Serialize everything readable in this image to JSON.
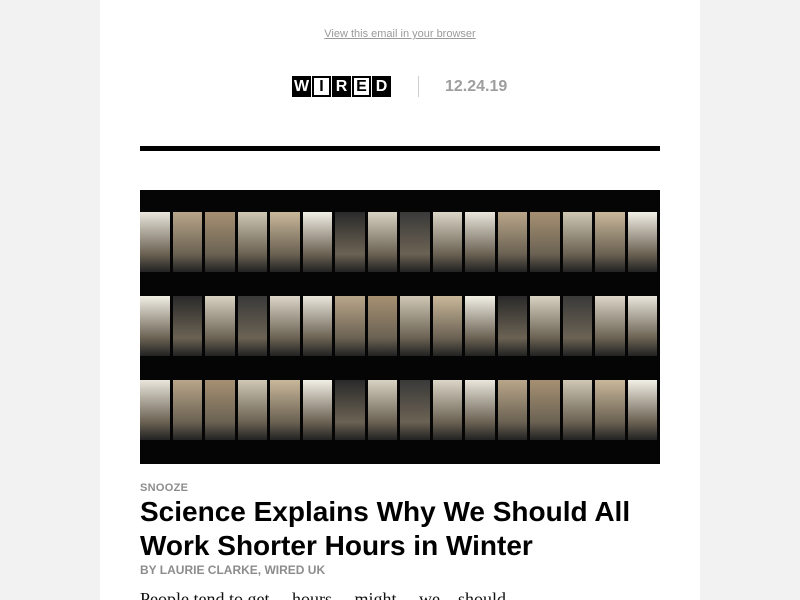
{
  "header": {
    "view_in_browser": "View this email in your browser",
    "logo_letters": [
      "W",
      "I",
      "R",
      "E",
      "D"
    ],
    "logo_text": "WIRED",
    "date": "12.24.19"
  },
  "article": {
    "kicker": "SNOOZE",
    "headline": "Science Explains Why We Should All Work Shorter Hours in Winter",
    "byline": "BY LAURIE CLARKE, WIRED UK",
    "hero_image_alt": "office building windows at night",
    "body_start": "People tend to get… hours …might… we…should…"
  },
  "colors": {
    "page_bg": "#f2f2f2",
    "card_bg": "#ffffff",
    "rule": "#000000",
    "muted_text": "#8c8c8c"
  }
}
